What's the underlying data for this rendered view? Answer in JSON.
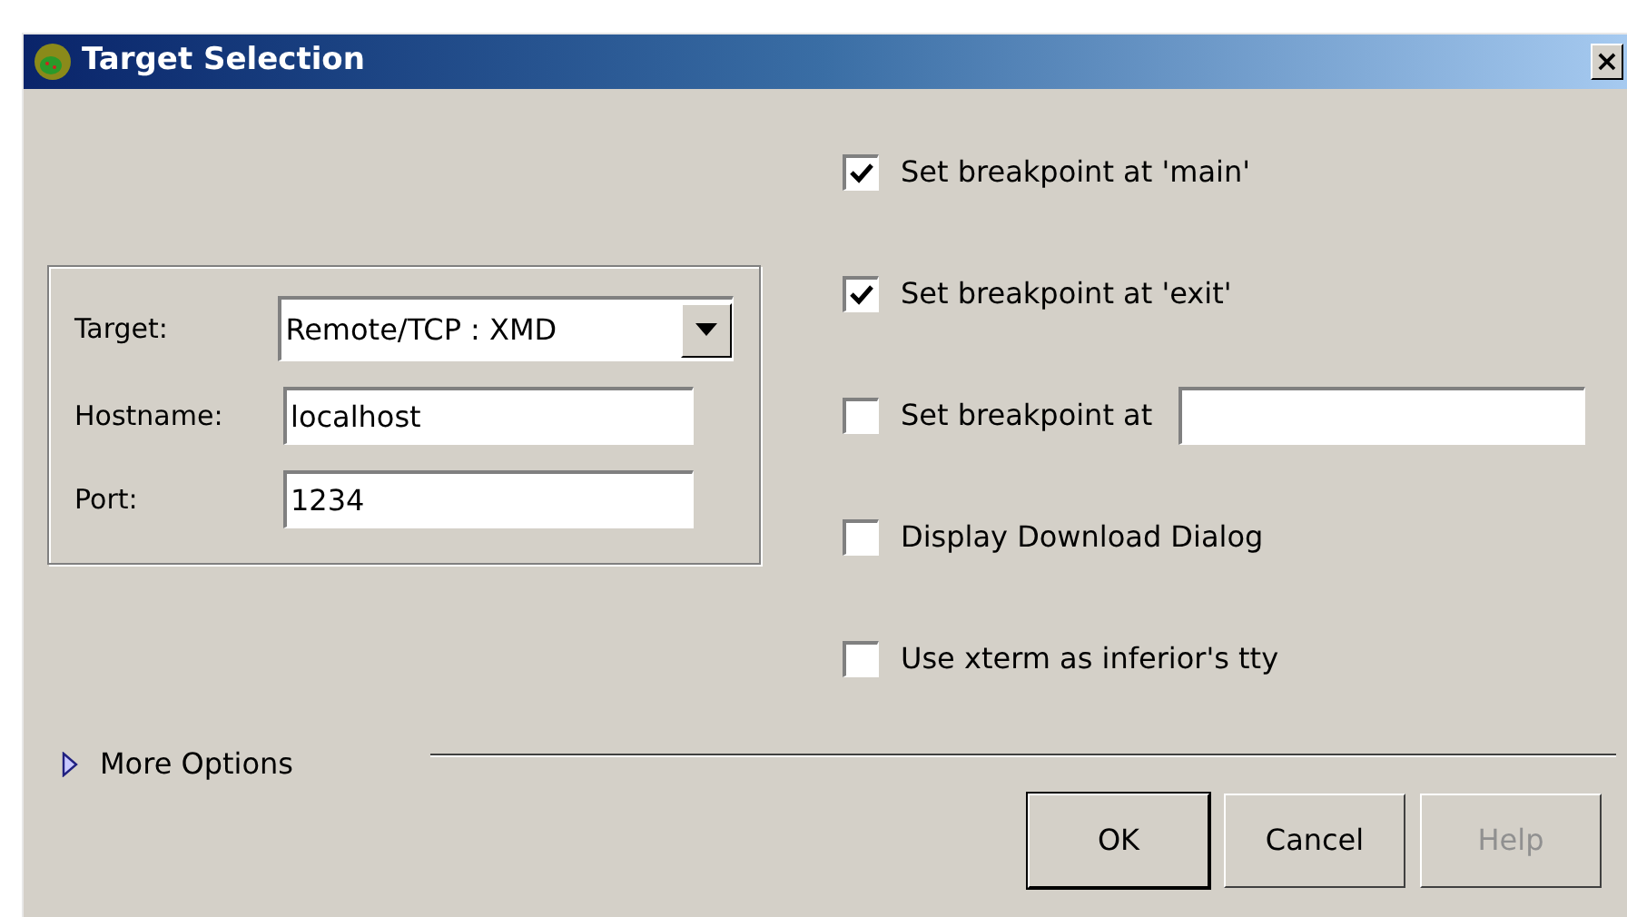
{
  "window": {
    "title": "Target Selection",
    "close": "×"
  },
  "connection": {
    "fields": [
      {
        "kind": "combo",
        "label": "Target:",
        "value": "Remote/TCP : XMD"
      },
      {
        "kind": "text",
        "label": "Hostname:",
        "value": "localhost"
      },
      {
        "kind": "text",
        "label": "Port:",
        "value": "1234"
      }
    ]
  },
  "options": [
    {
      "kind": "check",
      "label": "Set breakpoint at 'main'",
      "checked": true
    },
    {
      "kind": "check",
      "label": "Set breakpoint at 'exit'",
      "checked": true
    },
    {
      "kind": "check_field",
      "label": "Set breakpoint at",
      "checked": false
    },
    {
      "kind": "check",
      "label": "Display Download Dialog",
      "checked": false
    },
    {
      "kind": "check",
      "label": "Use xterm as inferior's tty",
      "checked": false
    }
  ],
  "more_options": {
    "label": "More Options",
    "expanded": false
  },
  "buttons": [
    {
      "label": "OK",
      "default": true,
      "disabled": false
    },
    {
      "label": "Cancel",
      "default": false,
      "disabled": false
    },
    {
      "label": "Help",
      "default": false,
      "disabled": true
    }
  ]
}
